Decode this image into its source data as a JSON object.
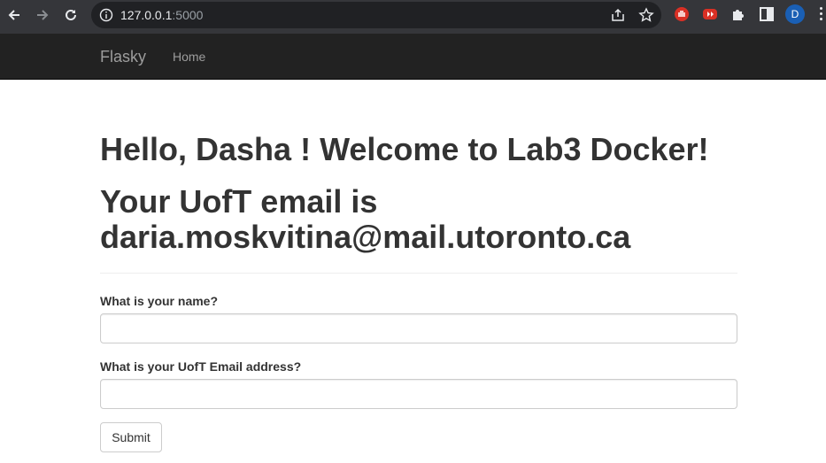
{
  "browser": {
    "url_host": "127.0.0.1",
    "url_port": ":5000",
    "profile_initial": "D",
    "icons": [
      "back-arrow-icon",
      "forward-arrow-icon",
      "reload-icon",
      "site-info-icon",
      "share-icon",
      "bookmark-star-icon",
      "extension-red-hand-icon",
      "extension-youtube-icon",
      "extensions-puzzle-icon",
      "side-panel-icon",
      "more-menu-icon"
    ]
  },
  "navbar": {
    "brand": "Flasky",
    "links": [
      {
        "label": "Home"
      }
    ]
  },
  "main": {
    "greeting": "Hello, Dasha ! Welcome to Lab3 Docker!",
    "email_message": "Your UofT email is daria.moskvitina@mail.utoronto.ca"
  },
  "form": {
    "name_label": "What is your name?",
    "name_value": "",
    "email_label": "What is your UofT Email address?",
    "email_value": "",
    "submit_label": "Submit"
  },
  "colors": {
    "chrome_bg": "#35363a",
    "omnibox_bg": "#202124",
    "navbar_bg": "#222222",
    "navbar_text": "#9d9d9d",
    "body_text": "#333333",
    "profile_bg": "#1a5fb4",
    "extension_red": "#d93025"
  }
}
